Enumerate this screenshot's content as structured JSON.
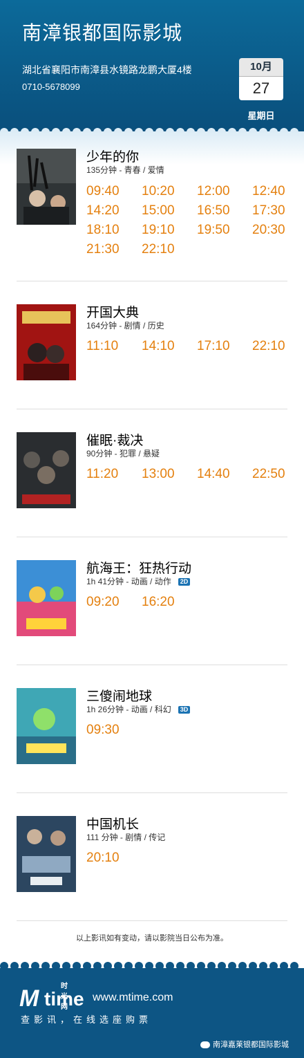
{
  "header": {
    "cinema_name": "南漳银都国际影城",
    "address": "湖北省襄阳市南漳县水镜路龙鹏大厦4楼",
    "phone": "0710-5678099",
    "date": {
      "month": "10月",
      "day": "27",
      "weekday": "星期日"
    }
  },
  "movies": [
    {
      "title": "少年的你",
      "meta": "135分钟 - 青春 / 爱情",
      "badge": "",
      "times": [
        "09:40",
        "10:20",
        "12:00",
        "12:40",
        "14:20",
        "15:00",
        "16:50",
        "17:30",
        "18:10",
        "19:10",
        "19:50",
        "20:30",
        "21:30",
        "22:10"
      ]
    },
    {
      "title": "开国大典",
      "meta": "164分钟 - 剧情 / 历史",
      "badge": "",
      "times": [
        "11:10",
        "14:10",
        "17:10",
        "22:10"
      ]
    },
    {
      "title": "催眠·裁决",
      "meta": "90分钟 - 犯罪 / 悬疑",
      "badge": "",
      "times": [
        "11:20",
        "13:00",
        "14:40",
        "22:50"
      ]
    },
    {
      "title": "航海王：狂热行动",
      "meta": "1h 41分钟 - 动画 / 动作",
      "badge": "2D",
      "times": [
        "09:20",
        "16:20"
      ]
    },
    {
      "title": "三傻闹地球",
      "meta": "1h 26分钟 - 动画 / 科幻",
      "badge": "3D",
      "times": [
        "09:30"
      ]
    },
    {
      "title": "中国机长",
      "meta": "111 分钟 - 剧情 / 传记",
      "badge": "",
      "times": [
        "20:10"
      ]
    }
  ],
  "notice": "以上影讯如有变动，请以影院当日公布为准。",
  "footer": {
    "logo_cn": "时光网",
    "logo_text": "time",
    "site": "www.mtime.com",
    "tagline": "查影讯，在线选座购票",
    "account": "南漳嘉莱银都国际影城"
  },
  "colors": {
    "header_bg": "#0a5a8a",
    "time_text": "#e4800f",
    "footer_bg": "#0d5584"
  },
  "icons": [
    "wechat-icon"
  ]
}
